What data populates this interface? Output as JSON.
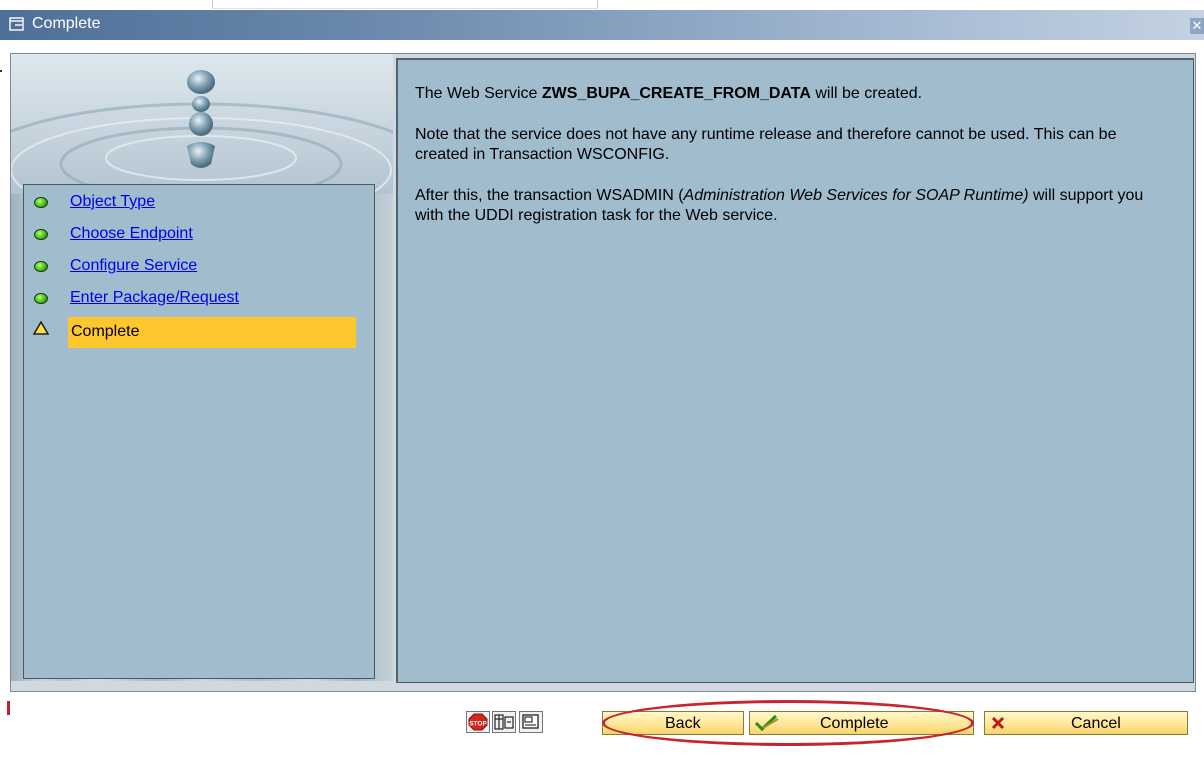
{
  "window": {
    "title": "Complete",
    "close_symbol": "✕"
  },
  "steps": [
    {
      "label": "Object Type",
      "status": "done",
      "icon": "green-light-icon"
    },
    {
      "label": "Choose Endpoint",
      "status": "done",
      "icon": "green-light-icon"
    },
    {
      "label": "Configure Service",
      "status": "done",
      "icon": "green-light-icon"
    },
    {
      "label": "Enter Package/Request",
      "status": "done",
      "icon": "green-light-icon"
    },
    {
      "label": "Complete",
      "status": "current",
      "icon": "yellow-triangle-icon"
    }
  ],
  "content": {
    "p1_prefix": "The Web Service ",
    "service_name": "ZWS_BUPA_CREATE_FROM_DATA",
    "p1_suffix": " will be created.",
    "p2": "Note that the service does not have any runtime release and therefore cannot be used. This can be created in Transaction WSCONFIG.",
    "p3_prefix": "After this, the transaction WSADMIN (",
    "p3_italic": "Administration Web Services for SOAP Runtime)",
    "p3_suffix": " will support you with the UDDI registration task for the Web service."
  },
  "toolbar": {
    "icons": [
      "stop-icon",
      "technical-info-icon",
      "display-icon"
    ],
    "back_label": "Back",
    "complete_label": "Complete",
    "cancel_label": "Cancel"
  },
  "colors": {
    "highlight": "#ffc72e",
    "panel": "#a0bccd",
    "annotation": "#c7242f"
  }
}
